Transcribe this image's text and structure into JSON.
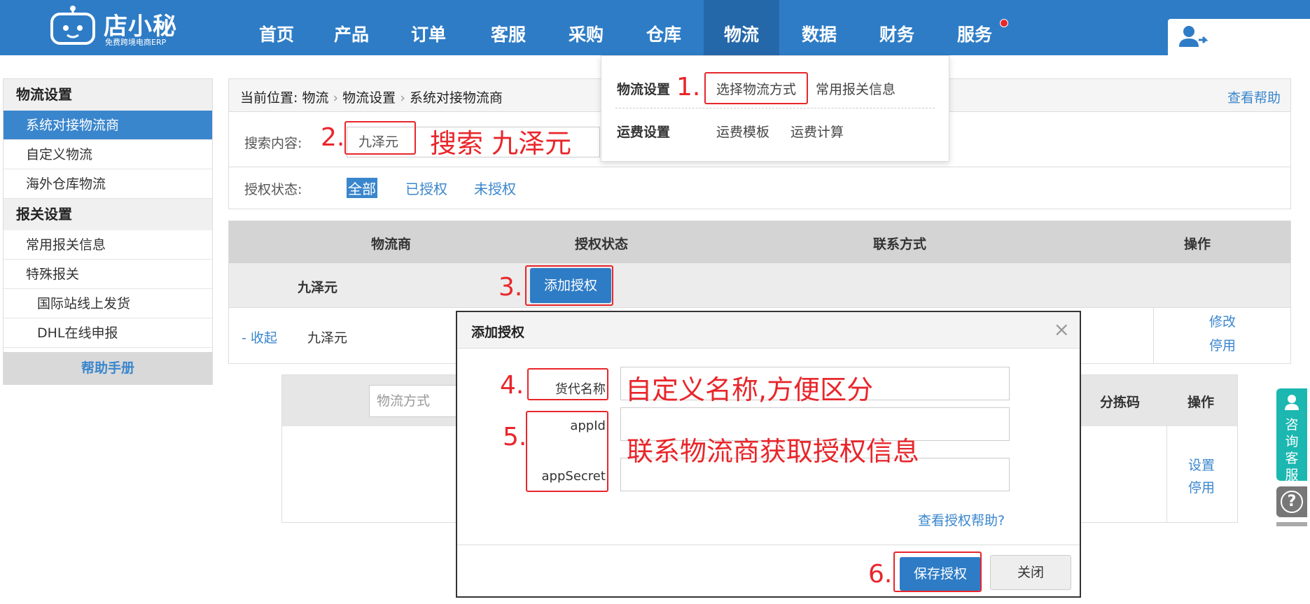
{
  "logo": {
    "name": "店小秘",
    "tagline": "免费跨境电商ERP"
  },
  "nav": {
    "items": [
      "首页",
      "产品",
      "订单",
      "客服",
      "采购",
      "仓库",
      "物流",
      "数据",
      "财务",
      "服务"
    ],
    "active": "物流"
  },
  "sidebar": {
    "section1": "物流设置",
    "items1": [
      "系统对接物流商",
      "自定义物流",
      "海外仓库物流"
    ],
    "section2": "报关设置",
    "items2": [
      "常用报关信息",
      "特殊报关"
    ],
    "subitems": [
      "国际站线上发货",
      "DHL在线申报"
    ],
    "help": "帮助手册"
  },
  "breadcrumb": {
    "prefix": "当前位置:",
    "c1": "物流",
    "c2": "物流设置",
    "c3": "系统对接物流商",
    "help_link": "查看帮助"
  },
  "search": {
    "label": "搜索内容:",
    "value": "九泽元",
    "auth_label": "授权状态:",
    "auth_options": [
      "全部",
      "已授权",
      "未授权"
    ]
  },
  "table": {
    "headers": [
      "物流商",
      "授权状态",
      "联系方式",
      "操作"
    ],
    "provider": "九泽元",
    "add_auth_button": "添加授权",
    "collapse": "- 收起",
    "row_name": "九泽元",
    "actions": [
      "修改",
      "停用"
    ]
  },
  "subtable": {
    "placeholder": "物流方式",
    "headers": [
      "分拣码",
      "操作"
    ],
    "actions": [
      "设置",
      "停用"
    ]
  },
  "dropdown": {
    "cat1": "物流设置",
    "links1": [
      "选择物流方式",
      "常用报关信息"
    ],
    "cat2": "运费设置",
    "links2": [
      "运费模板",
      "运费计算"
    ]
  },
  "modal": {
    "title": "添加授权",
    "close_glyph": "×",
    "label_name": "货代名称:",
    "label_appid": "appId:",
    "label_secret": "appSecret:",
    "help_link": "查看授权帮助?",
    "save_button": "保存授权",
    "close_button": "关闭"
  },
  "annotations": {
    "n1": "1.",
    "n2": "2.",
    "n3": "3.",
    "n4": "4.",
    "n5": "5.",
    "n6": "6.",
    "search_hint": "搜索 九泽元",
    "name_hint": "自定义名称,方便区分",
    "auth_hint": "联系物流商获取授权信息"
  },
  "widgets": {
    "customer_service": "咨询客服",
    "help": "?"
  },
  "colors": {
    "primary": "#2e7cc6",
    "annotation": "#e8262b",
    "widget": "#1bb7b0"
  }
}
